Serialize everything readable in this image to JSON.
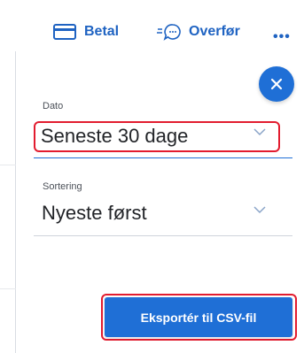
{
  "toolbar": {
    "pay_label": "Betal",
    "transfer_label": "Overfør",
    "more_label": "•••"
  },
  "filters": {
    "date": {
      "label": "Dato",
      "value": "Seneste 30 dage"
    },
    "sort": {
      "label": "Sortering",
      "value": "Nyeste først"
    }
  },
  "export": {
    "label": "Eksportér til CSV-fil"
  },
  "colors": {
    "accent": "#1f6fd6",
    "link": "#1f63c2",
    "highlight": "#e21c2f"
  },
  "icons": {
    "pay": "credit-card-icon",
    "transfer": "chat-bubble-icon",
    "close": "close-icon",
    "dropdown": "chevron-down-icon"
  }
}
